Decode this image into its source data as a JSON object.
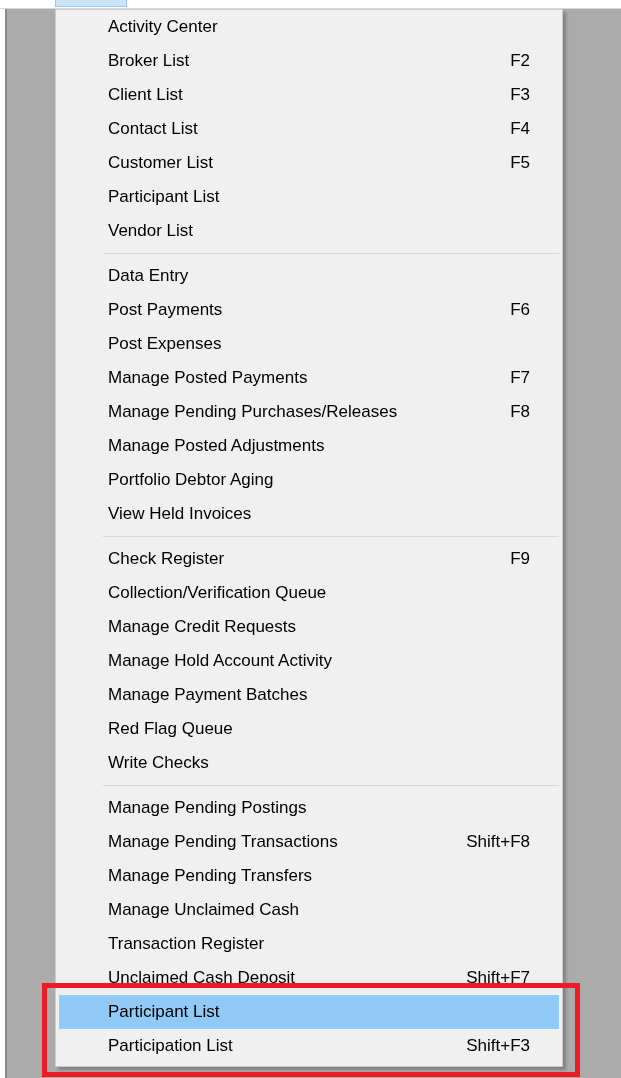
{
  "menu": {
    "groups": [
      {
        "items": [
          {
            "label": "Activity Center",
            "selected": false
          },
          {
            "label": "Broker List",
            "shortcut": "F2",
            "selected": false
          },
          {
            "label": "Client List",
            "shortcut": "F3",
            "selected": false
          },
          {
            "label": "Contact List",
            "shortcut": "F4",
            "selected": false
          },
          {
            "label": "Customer List",
            "shortcut": "F5",
            "selected": false
          },
          {
            "label": "Participant List",
            "selected": false
          },
          {
            "label": "Vendor List",
            "selected": false
          }
        ]
      },
      {
        "items": [
          {
            "label": "Data Entry",
            "selected": false
          },
          {
            "label": "Post Payments",
            "shortcut": "F6",
            "selected": false
          },
          {
            "label": "Post Expenses",
            "selected": false
          },
          {
            "label": "Manage Posted Payments",
            "shortcut": "F7",
            "selected": false
          },
          {
            "label": "Manage Pending Purchases/Releases",
            "shortcut": "F8",
            "selected": false
          },
          {
            "label": "Manage Posted Adjustments",
            "selected": false
          },
          {
            "label": "Portfolio Debtor Aging",
            "selected": false
          },
          {
            "label": "View Held Invoices",
            "selected": false
          }
        ]
      },
      {
        "items": [
          {
            "label": "Check Register",
            "shortcut": "F9",
            "selected": false
          },
          {
            "label": "Collection/Verification Queue",
            "selected": false
          },
          {
            "label": "Manage Credit Requests",
            "selected": false
          },
          {
            "label": "Manage Hold Account Activity",
            "selected": false
          },
          {
            "label": "Manage Payment Batches",
            "selected": false
          },
          {
            "label": "Red Flag Queue",
            "selected": false
          },
          {
            "label": "Write Checks",
            "selected": false
          }
        ]
      },
      {
        "items": [
          {
            "label": "Manage Pending Postings",
            "selected": false
          },
          {
            "label": "Manage Pending Transactions",
            "shortcut": "Shift+F8",
            "selected": false
          },
          {
            "label": "Manage Pending Transfers",
            "selected": false
          },
          {
            "label": "Manage Unclaimed Cash",
            "selected": false
          },
          {
            "label": "Transaction Register",
            "selected": false
          },
          {
            "label": "Unclaimed Cash Deposit",
            "shortcut": "Shift+F7",
            "selected": false
          }
        ]
      },
      {
        "outlined": true,
        "items": [
          {
            "label": "Participant List",
            "selected": true
          },
          {
            "label": "Participation List",
            "shortcut": "Shift+F3",
            "selected": false
          }
        ]
      }
    ]
  }
}
